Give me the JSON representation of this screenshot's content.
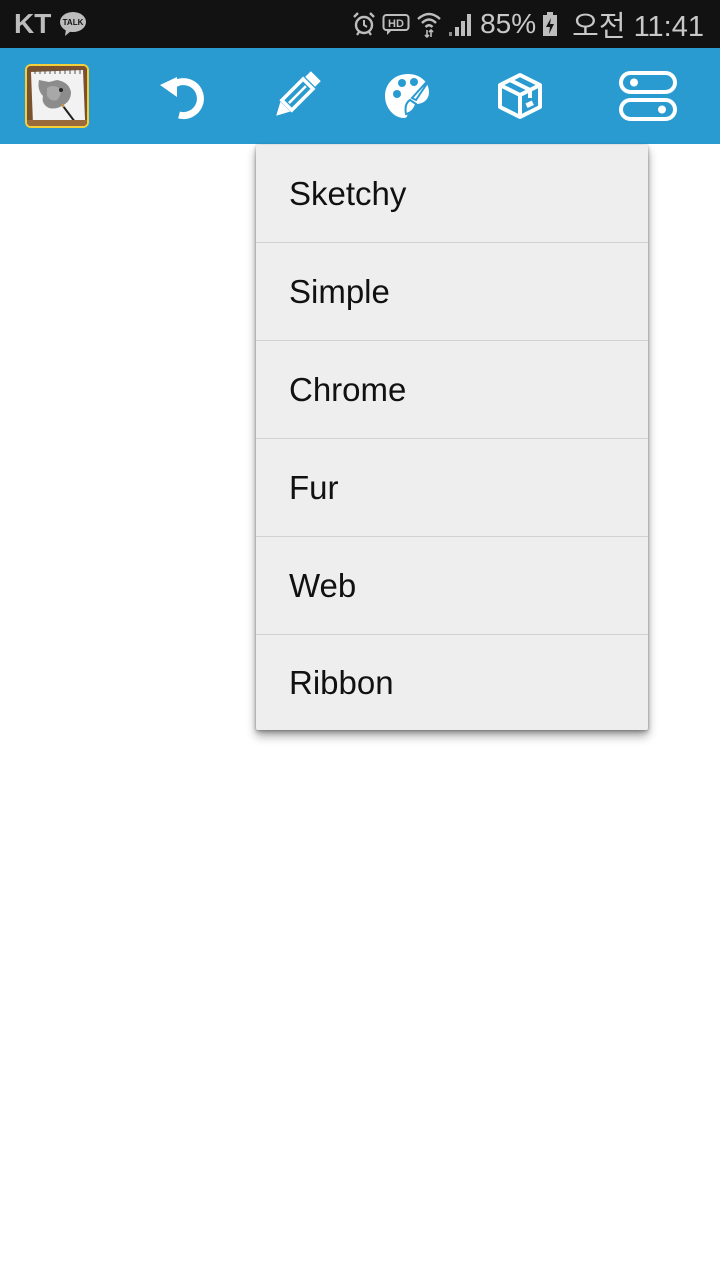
{
  "status_bar": {
    "carrier": "KT",
    "notification_icons": [
      "kakaotalk-icon"
    ],
    "system_icons": [
      "alarm-icon",
      "hd-voice-icon",
      "wifi-icon",
      "signal-icon",
      "battery-charging-icon"
    ],
    "talk_label": "TALK",
    "hd_label": "HD",
    "battery_percent": "85%",
    "time": "오전 11:41"
  },
  "toolbar": {
    "background_color": "#2a9bd0",
    "buttons": [
      {
        "name": "app-thumbnail",
        "icon": "sketch-dog-thumbnail"
      },
      {
        "name": "undo",
        "icon": "undo-icon"
      },
      {
        "name": "brush",
        "icon": "pencil-icon"
      },
      {
        "name": "palette",
        "icon": "palette-icon"
      },
      {
        "name": "package",
        "icon": "box-icon"
      },
      {
        "name": "settings",
        "icon": "toggles-icon"
      }
    ]
  },
  "brush_menu": {
    "items": [
      {
        "label": "Sketchy"
      },
      {
        "label": "Simple"
      },
      {
        "label": "Chrome"
      },
      {
        "label": "Fur"
      },
      {
        "label": "Web"
      },
      {
        "label": "Ribbon"
      }
    ]
  }
}
